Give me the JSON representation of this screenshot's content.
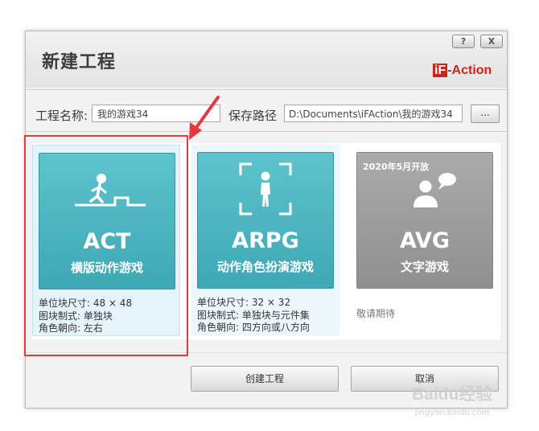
{
  "dialog": {
    "title": "新建工程",
    "help_label": "?",
    "close_label": "X",
    "logo": {
      "prefix": "iF",
      "suffix": "-Action"
    },
    "accent_color": "#c9251b"
  },
  "form": {
    "name_label": "工程名称:",
    "name_value": "我的游戏34",
    "path_label": "保存路径",
    "path_value": "D:\\Documents\\iFAction\\我的游戏34",
    "browse_label": "..."
  },
  "templates": [
    {
      "name": "ACT",
      "subtitle": "横版动作游戏",
      "icon": "running-figure-icon",
      "info": [
        "单位块尺寸: 48 × 48",
        "图块制式: 单独块",
        "角色朝向: 左右"
      ],
      "selected": true,
      "color": "#4db6c1"
    },
    {
      "name": "ARPG",
      "subtitle": "动作角色扮演游戏",
      "icon": "framed-figure-icon",
      "info": [
        "单位块尺寸: 32 × 32",
        "图块制式: 单独块与元件集",
        "角色朝向: 四方向或八方向"
      ],
      "selected": false,
      "color": "#4db6c1"
    },
    {
      "name": "AVG",
      "subtitle": "文字游戏",
      "badge": "2020年5月开放",
      "icon": "person-speech-icon",
      "info": [
        "敬请期待"
      ],
      "selected": false,
      "color": "#9a9a9a"
    }
  ],
  "buttons": {
    "create_label": "创建工程",
    "cancel_label": "取消"
  },
  "annotation": {
    "color": "#e6393d"
  },
  "watermark": {
    "main": "Baidu经验",
    "sub": "jingyan.baidu.com"
  }
}
